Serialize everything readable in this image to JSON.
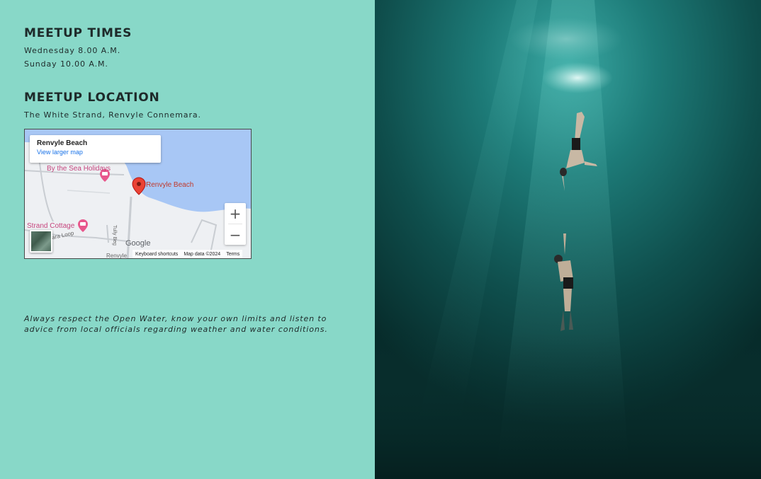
{
  "meetup_times": {
    "heading": "MEETUP TIMES",
    "lines": [
      "Wednesday 8.00 A.M.",
      "Sunday 10.00 A.M."
    ]
  },
  "meetup_location": {
    "heading": "MEETUP LOCATION",
    "address": "The White Strand, Renvyle Connemara."
  },
  "map": {
    "place_title": "Renvyle Beach",
    "view_larger": "View larger map",
    "zoom_in": "+",
    "zoom_out": "−",
    "labels": {
      "by_the_sea": "By the Sea Holidays",
      "renvyle_beach": "Renvyle Beach",
      "strand_cottage": "Strand Cottage",
      "tully_beg": "Tully Beg",
      "loop": "ara Loop",
      "renvyle_partial": "Renvyle",
      "google": "Google"
    },
    "footer": {
      "shortcuts": "Keyboard shortcuts",
      "map_data": "Map data ©2024",
      "terms": "Terms"
    },
    "colors": {
      "water": "#a8c7f5",
      "pin": "#ea4335",
      "poi": "#e8578c"
    }
  },
  "note": "Always respect the Open Water, know your own limits and listen to advice from local officials regarding weather and water conditions.",
  "colors": {
    "background": "#88d8c8",
    "text": "#1e2a2a",
    "water_dark": "#0c3f3d"
  }
}
